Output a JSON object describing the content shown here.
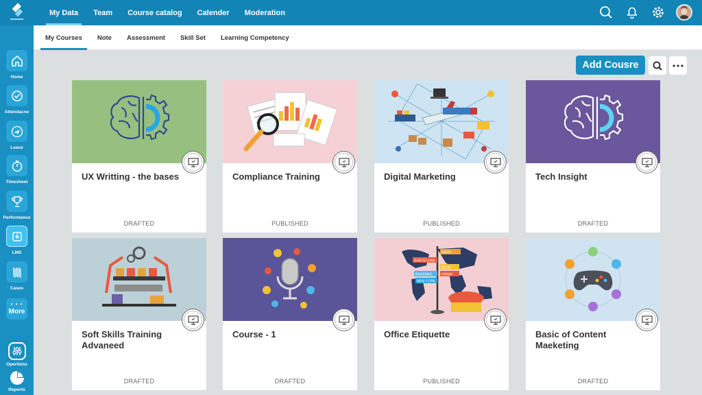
{
  "rail": {
    "items": [
      {
        "label": "Home",
        "icon": "home-icon"
      },
      {
        "label": "Attendacne",
        "icon": "clock-check-icon"
      },
      {
        "label": "Leave",
        "icon": "plane-icon"
      },
      {
        "label": "Timesheet",
        "icon": "timer-icon"
      },
      {
        "label": "Performance",
        "icon": "trophy-icon"
      },
      {
        "label": "LMS",
        "icon": "download-icon"
      },
      {
        "label": "Cases",
        "icon": "cases-icon"
      }
    ],
    "more_label": "More",
    "more_dots": "• • •",
    "bottom": [
      {
        "label": "Opertions",
        "icon": "sliders-icon"
      },
      {
        "label": "Reports",
        "icon": "pie-chart-icon"
      }
    ]
  },
  "topnav": {
    "items": [
      "My Data",
      "Team",
      "Course catalog",
      "Calender",
      "Moderation"
    ],
    "active": "My Data"
  },
  "subtabs": {
    "items": [
      "My Courses",
      "Note",
      "Assessment",
      "Skill Set",
      "Learning Competency"
    ],
    "active": "My Courses"
  },
  "toolbar": {
    "add_label": "Add Cousre",
    "search_icon": "search-icon",
    "more_icon": "more-horizontal-icon"
  },
  "courses": [
    {
      "title": "UX Writting - the bases",
      "status": "DRAFTED",
      "bg": "#97c080",
      "art": "brain-gear"
    },
    {
      "title": "Compliance Training",
      "status": "PUBLISHED",
      "bg": "#f5d1d5",
      "art": "documents"
    },
    {
      "title": "Digital Marketing",
      "status": "PUBLISHED",
      "bg": "#cfe4f2",
      "art": "logistics"
    },
    {
      "title": "Tech Insight",
      "status": "DRAFTED",
      "bg": "#6a579c",
      "art": "brain-gear"
    },
    {
      "title": "Soft Skills Training Advaneed",
      "status": "DRAFTED",
      "bg": "#bcd0d7",
      "art": "factory"
    },
    {
      "title": "Course - 1",
      "status": "DRAFTED",
      "bg": "#5a5499",
      "art": "microphone"
    },
    {
      "title": "Office Etiquette",
      "status": "PUBLISHED",
      "bg": "#f3cfd4",
      "art": "travel"
    },
    {
      "title": "Basic of Content Maeketing",
      "status": "DRAFTED",
      "bg": "#cfe3f1",
      "art": "gamepad"
    }
  ],
  "signposts": [
    "PARIS",
    "BARCELONA",
    "IBIZA",
    "BAHAMAS",
    "HAWAI",
    "NEW YORK"
  ],
  "colors": {
    "primary": "#1384b6",
    "rail": "#1a8fc1",
    "accent": "#1a8fc1",
    "page_bg": "#dcdfe0"
  }
}
